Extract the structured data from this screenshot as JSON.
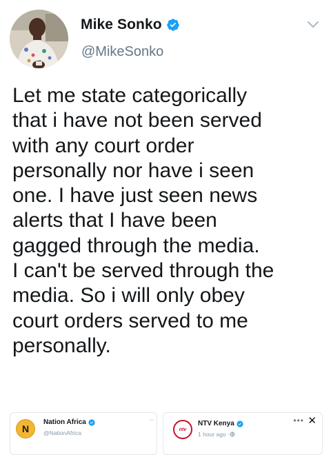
{
  "tweet": {
    "author_name": "Mike Sonko",
    "author_handle": "@MikeSonko",
    "verified": true,
    "text_lines": [
      "Let me state categorically",
      "that i have not been served",
      "with any court order",
      "personally nor have i seen",
      "one. I have just seen news",
      "alerts that I have been",
      "gagged through the media.",
      "I can't be served through the",
      "media. So i will only obey",
      "court orders served to me",
      "personally."
    ]
  },
  "embeds": {
    "nation": {
      "name": "Nation Africa",
      "handle": "@NationAfrica",
      "logo_letter": "N"
    },
    "ntv": {
      "name": "NTV Kenya",
      "meta": "1 hour ago · ",
      "logo_text": "ntv",
      "more": "•••",
      "close": "✕"
    }
  },
  "colors": {
    "verified_blue": "#1da1f2",
    "text": "#14171a",
    "secondary": "#657786",
    "nation_gold": "#f2b632",
    "ntv_red": "#c8102e"
  },
  "icons": {
    "chevron": "chevron-down-icon",
    "verified": "verified-badge-icon",
    "globe": "globe-icon"
  }
}
